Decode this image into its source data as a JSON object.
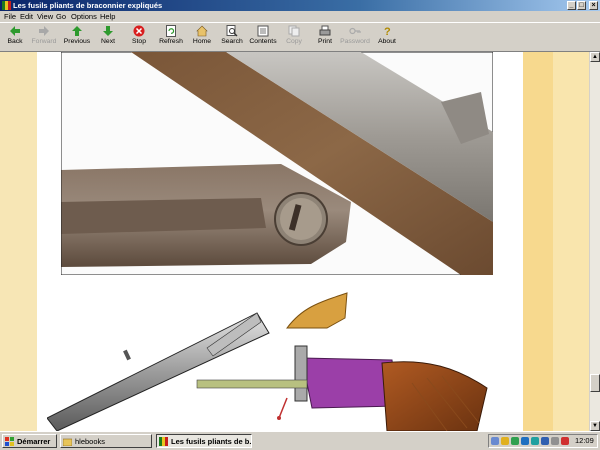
{
  "window": {
    "title": "Les fusils pliants de braconnier expliqués",
    "buttons": [
      "_",
      "□",
      "×"
    ]
  },
  "menu": [
    "File",
    "Edit",
    "View",
    "Go",
    "Options",
    "Help"
  ],
  "toolbar": [
    {
      "label": "Back",
      "icon": "arrow-left-icon",
      "enabled": true
    },
    {
      "label": "Forward",
      "icon": "arrow-right-icon",
      "enabled": false
    },
    {
      "label": "Previous",
      "icon": "arrow-up-icon",
      "enabled": true
    },
    {
      "label": "Next",
      "icon": "arrow-down-icon",
      "enabled": true
    },
    {
      "label": "Stop",
      "icon": "stop-icon",
      "enabled": true
    },
    {
      "label": "Refresh",
      "icon": "refresh-icon",
      "enabled": true
    },
    {
      "label": "Home",
      "icon": "home-icon",
      "enabled": true
    },
    {
      "label": "Search",
      "icon": "search-icon",
      "enabled": true
    },
    {
      "label": "Contents",
      "icon": "contents-icon",
      "enabled": true
    },
    {
      "label": "Copy",
      "icon": "copy-icon",
      "enabled": false
    },
    {
      "label": "Print",
      "icon": "print-icon",
      "enabled": true
    },
    {
      "label": "Password",
      "icon": "key-icon",
      "enabled": false
    },
    {
      "label": "About",
      "icon": "question-icon",
      "enabled": true
    }
  ],
  "colors": {
    "titlebar": "#0a246a",
    "page_bg": "#ffffff",
    "side_band": "#f7d98e",
    "stop_red": "#d81e1e",
    "arrow_green": "#2e9a2e",
    "frame_purple": "#9b3fa8",
    "stock_brown": "#8a4a1c"
  },
  "taskbar": {
    "start_label": "Démarrer",
    "tasks": [
      {
        "label": "hlebooks",
        "active": false
      },
      {
        "label": "Les fusils pliants de b...",
        "active": true
      }
    ],
    "clock": "12:09"
  }
}
